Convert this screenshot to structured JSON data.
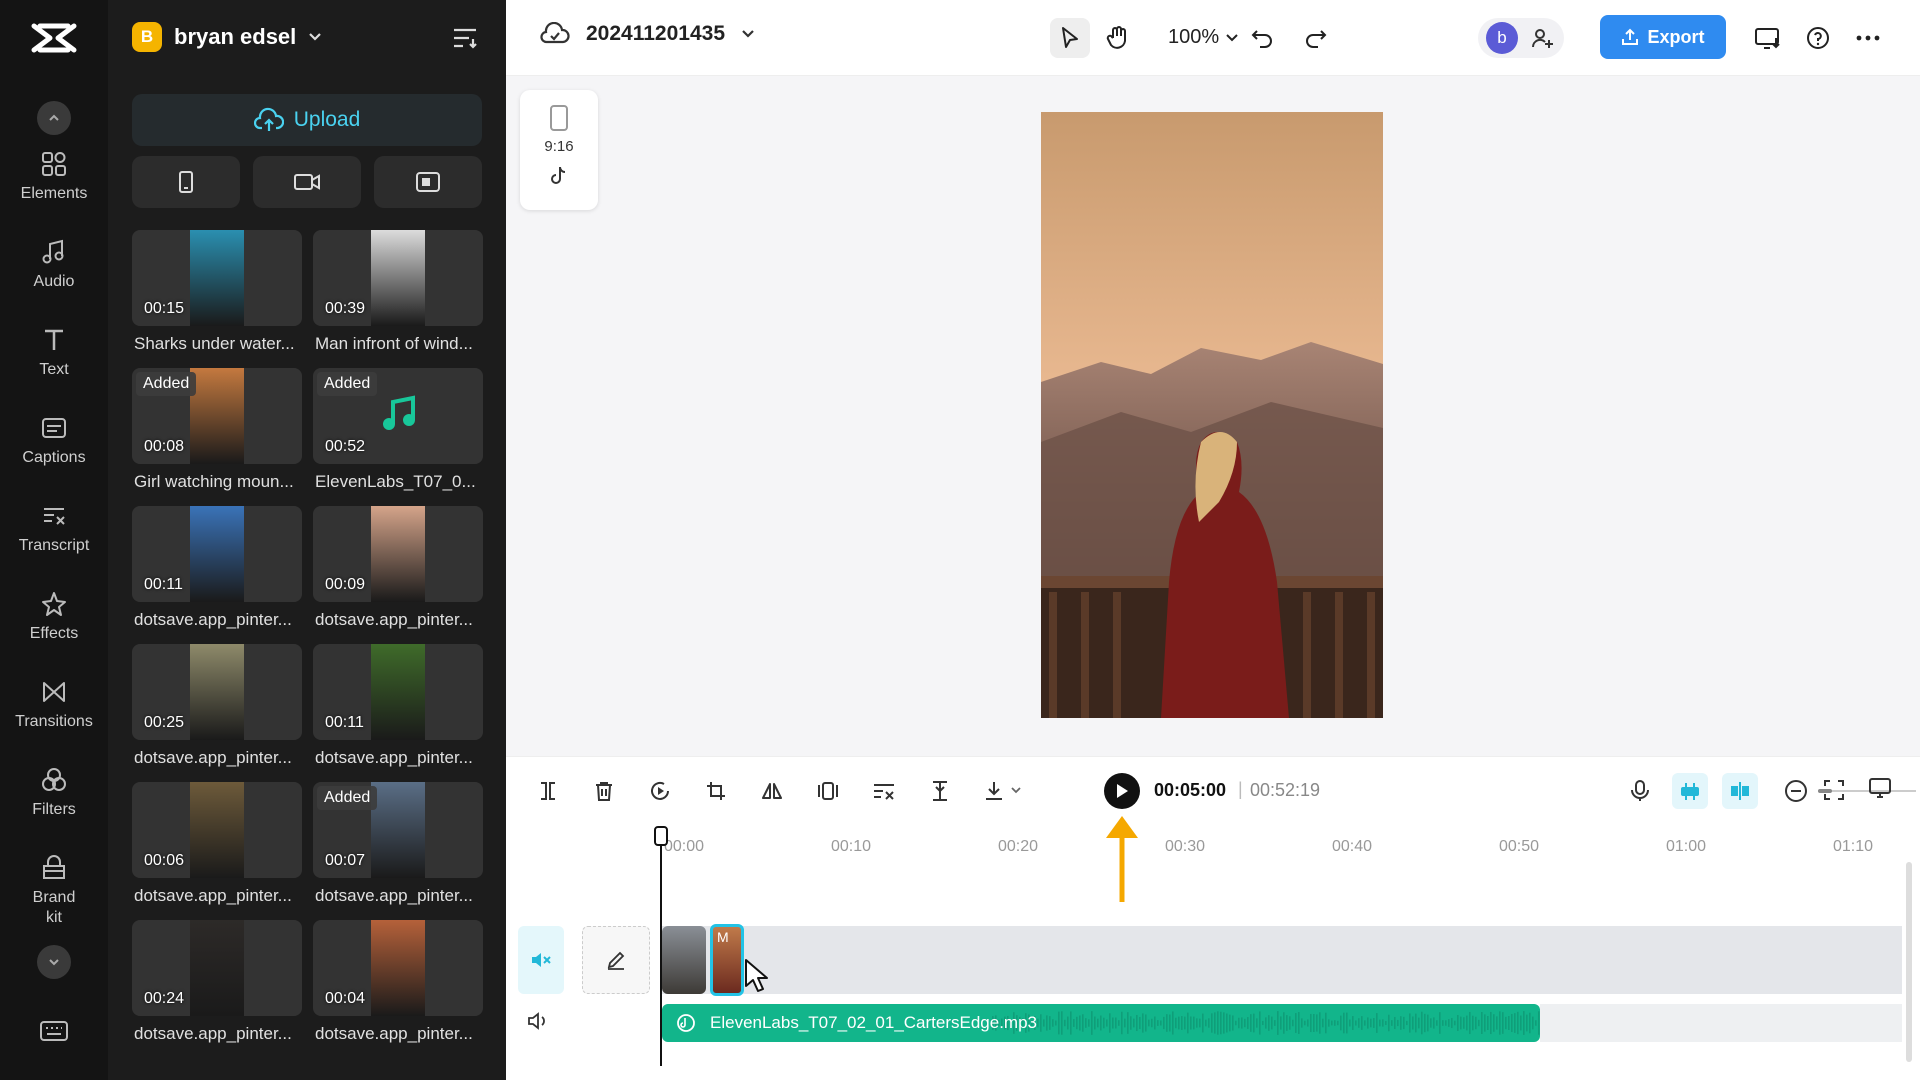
{
  "rail": {
    "items": [
      {
        "label": "Elements",
        "icon": "elements-icon"
      },
      {
        "label": "Audio",
        "icon": "audio-icon"
      },
      {
        "label": "Text",
        "icon": "text-icon"
      },
      {
        "label": "Captions",
        "icon": "captions-icon"
      },
      {
        "label": "Transcript",
        "icon": "transcript-icon"
      },
      {
        "label": "Effects",
        "icon": "effects-icon"
      },
      {
        "label": "Transitions",
        "icon": "transitions-icon"
      },
      {
        "label": "Filters",
        "icon": "filters-icon"
      },
      {
        "label": "Brand kit",
        "icon": "brand-kit-icon"
      }
    ]
  },
  "panel": {
    "account_initial": "B",
    "account_name": "bryan edsel",
    "upload_label": "Upload",
    "media": [
      {
        "duration": "00:15",
        "label": "Sharks under water...",
        "added": "",
        "color": "#2a8fb0"
      },
      {
        "duration": "00:39",
        "label": "Man infront of wind...",
        "added": "",
        "color": "#dcdcdc"
      },
      {
        "duration": "00:08",
        "label": "Girl watching moun...",
        "added": "Added",
        "color": "#c4793f"
      },
      {
        "duration": "00:52",
        "label": "ElevenLabs_T07_0...",
        "added": "Added",
        "color": "audio"
      },
      {
        "duration": "00:11",
        "label": "dotsave.app_pinter...",
        "added": "",
        "color": "#3a73b8"
      },
      {
        "duration": "00:09",
        "label": "dotsave.app_pinter...",
        "added": "",
        "color": "#d5a48a"
      },
      {
        "duration": "00:25",
        "label": "dotsave.app_pinter...",
        "added": "",
        "color": "#8e8a6a"
      },
      {
        "duration": "00:11",
        "label": "dotsave.app_pinter...",
        "added": "",
        "color": "#3f6b2a"
      },
      {
        "duration": "00:06",
        "label": "dotsave.app_pinter...",
        "added": "",
        "color": "#6d5a3a"
      },
      {
        "duration": "00:07",
        "label": "dotsave.app_pinter...",
        "added": "Added",
        "color": "#5a6e86"
      },
      {
        "duration": "00:24",
        "label": "dotsave.app_pinter...",
        "added": "",
        "color": "#2d2a28"
      },
      {
        "duration": "00:04",
        "label": "dotsave.app_pinter...",
        "added": "",
        "color": "#b5613a"
      }
    ]
  },
  "topbar": {
    "project_name": "202411201435",
    "zoom": "100%",
    "avatar_initial": "b",
    "export_label": "Export"
  },
  "stage": {
    "ratio_label": "9:16"
  },
  "toolbar": {
    "current_time": "00:05:00",
    "separator": "|",
    "total_time": "00:52:19"
  },
  "timeline": {
    "ticks": [
      "00:00",
      "00:10",
      "00:20",
      "00:30",
      "00:40",
      "00:50",
      "01:00",
      "01:10"
    ],
    "clip2_label": "M",
    "audio_name": "ElevenLabs_T07_02_01_CartersEdge.mp3"
  },
  "colors": {
    "accent": "#2f8bf0",
    "upload_text": "#4ad2f0",
    "audio_track": "#12b58b",
    "annotation_arrow": "#f5a800"
  }
}
